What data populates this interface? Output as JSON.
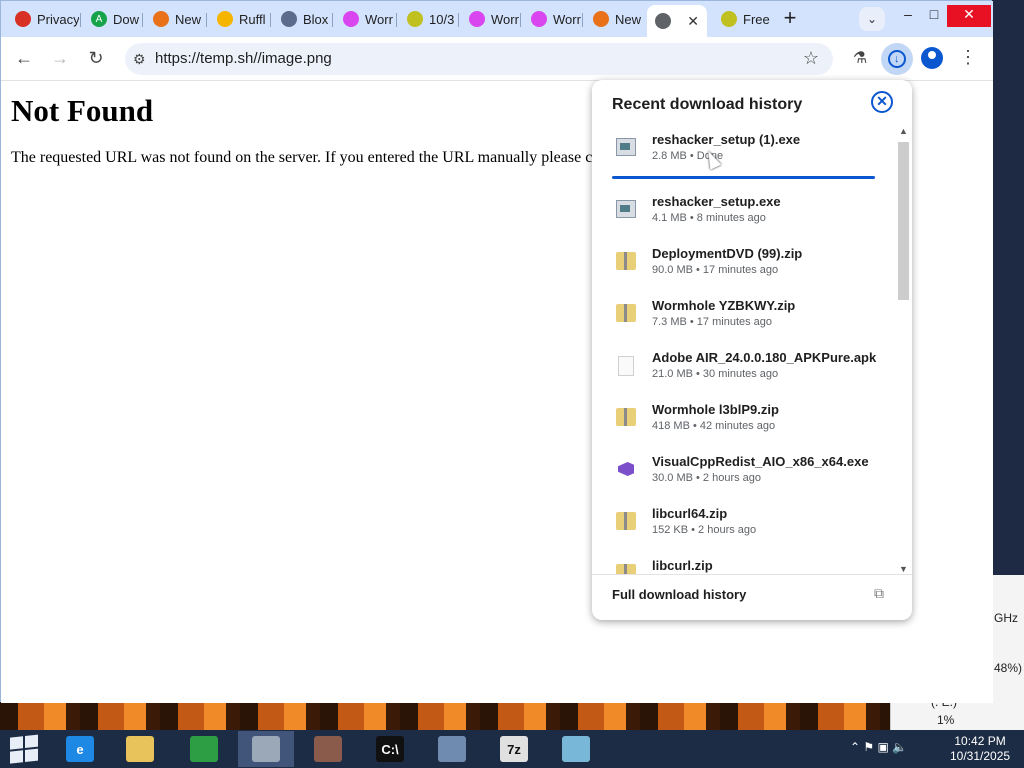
{
  "tabs": [
    {
      "title": "Privacy erro",
      "fav_color": "#d93025",
      "fav_glyph": ""
    },
    {
      "title": "Dow",
      "fav_color": "#16a34a",
      "fav_glyph": "A"
    },
    {
      "title": "New",
      "fav_color": "#e8711a",
      "fav_glyph": ""
    },
    {
      "title": "Ruffl",
      "fav_color": "#f5b400",
      "fav_glyph": ""
    },
    {
      "title": "Blox",
      "fav_color": "#5b6b8c",
      "fav_glyph": ""
    },
    {
      "title": "Worr",
      "fav_color": "#d946ef",
      "fav_glyph": ""
    },
    {
      "title": "10/3",
      "fav_color": "#c0c020",
      "fav_glyph": ""
    },
    {
      "title": "Worr",
      "fav_color": "#d946ef",
      "fav_glyph": ""
    },
    {
      "title": "Worr",
      "fav_color": "#d946ef",
      "fav_glyph": ""
    },
    {
      "title": "New",
      "fav_color": "#e8711a",
      "fav_glyph": ""
    },
    {
      "title": "",
      "fav_color": "#5f6368",
      "fav_glyph": ""
    },
    {
      "title": "Free",
      "fav_color": "#c0c020",
      "fav_glyph": ""
    }
  ],
  "window": {
    "minimize": "–",
    "maximize": "□",
    "close": "✕"
  },
  "address": {
    "url": "https://temp.sh//image.png"
  },
  "page": {
    "heading": "Not Found",
    "body": "The requested URL was not found on the server. If you entered the URL manually please c"
  },
  "downloads": {
    "title": "Recent download history",
    "items": [
      {
        "name": "reshacker_setup (1).exe",
        "meta": "2.8 MB • Done",
        "type": "exe",
        "progress": 1.0
      },
      {
        "name": "reshacker_setup.exe",
        "meta": "4.1 MB • 8 minutes ago",
        "type": "exe"
      },
      {
        "name": "DeploymentDVD (99).zip",
        "meta": "90.0 MB • 17 minutes ago",
        "type": "zip"
      },
      {
        "name": "Wormhole YZBKWY.zip",
        "meta": "7.3 MB • 17 minutes ago",
        "type": "zip"
      },
      {
        "name": "Adobe AIR_24.0.0.180_APKPure.apk",
        "meta": "21.0 MB • 30 minutes ago",
        "type": "blank"
      },
      {
        "name": "Wormhole l3blP9.zip",
        "meta": "418 MB • 42 minutes ago",
        "type": "zip"
      },
      {
        "name": "VisualCppRedist_AIO_x86_x64.exe",
        "meta": "30.0 MB • 2 hours ago",
        "type": "vs"
      },
      {
        "name": "libcurl64.zip",
        "meta": "152 KB • 2 hours ago",
        "type": "zip"
      },
      {
        "name": "libcurl.zip",
        "meta": "",
        "type": "zip"
      }
    ],
    "footer": "Full download history"
  },
  "sysinfo": {
    "ghz": "GHz",
    "pct": "48%)",
    "drive": "(: E:)",
    "one": "1%"
  },
  "taskbar": {
    "apps": [
      {
        "name": "internet-explorer",
        "color": "#1e88e5",
        "glyph": "e"
      },
      {
        "name": "file-explorer",
        "color": "#e8c25a",
        "glyph": ""
      },
      {
        "name": "store",
        "color": "#2e9e44",
        "glyph": ""
      },
      {
        "name": "chrome",
        "color": "#9aa8b8",
        "glyph": ""
      },
      {
        "name": "photo-app",
        "color": "#8a5a4a",
        "glyph": ""
      },
      {
        "name": "command-prompt",
        "color": "#111111",
        "glyph": "C:\\"
      },
      {
        "name": "task-manager",
        "color": "#6f8cb0",
        "glyph": ""
      },
      {
        "name": "7zip",
        "color": "#e0e0e0",
        "glyph": "7z"
      },
      {
        "name": "notepad",
        "color": "#79b7d8",
        "glyph": ""
      }
    ],
    "time": "10:42 PM",
    "date": "10/31/2025"
  }
}
